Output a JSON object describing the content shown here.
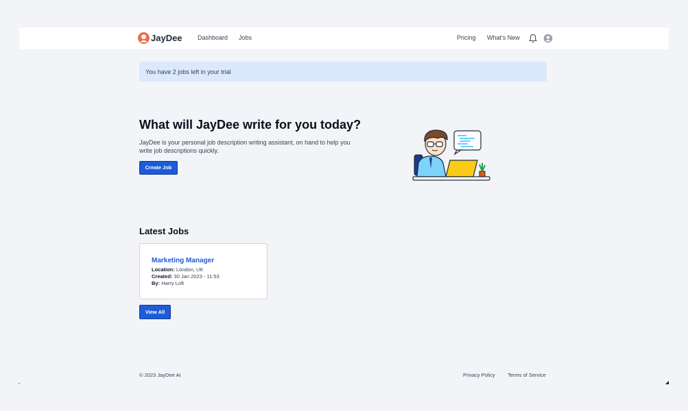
{
  "brand": {
    "name": "JayDee",
    "accent": "#e8704a"
  },
  "nav": {
    "left": [
      "Dashboard",
      "Jobs"
    ],
    "right": [
      "Pricing",
      "What's New"
    ],
    "icons": [
      "bell-icon",
      "user-avatar-icon"
    ]
  },
  "banner": {
    "text": "You have 2 jobs left in your trial"
  },
  "hero": {
    "title": "What will JayDee write for you today?",
    "description": "JayDee is your personal job description writing assistant, on hand to help you write job descriptions quickly.",
    "cta": "Create Job"
  },
  "latest": {
    "title": "Latest Jobs",
    "jobs": [
      {
        "title": "Marketing Manager",
        "location_label": "Location:",
        "location": "London, UK",
        "created_label": "Created:",
        "created": "30 Jan 2023 - 11:53",
        "by_label": "By:",
        "by": "Harry Loft"
      }
    ],
    "view_all": "View All"
  },
  "footer": {
    "copyright": "© 2023 JayDee AI",
    "links": [
      "Privacy Policy",
      "Terms of Service"
    ]
  },
  "colors": {
    "primary": "#1d5bd8",
    "banner_bg": "#dce8fc",
    "page_bg": "#f2f4f7"
  }
}
